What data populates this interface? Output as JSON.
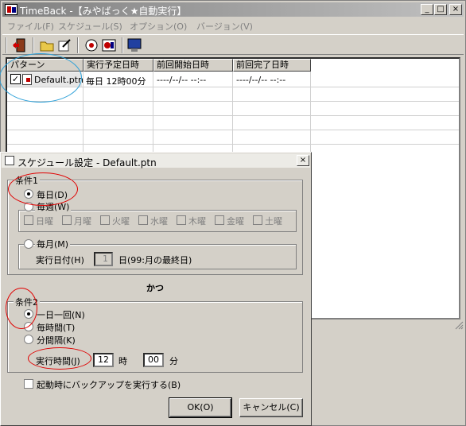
{
  "window": {
    "title": "TimeBack -【みやばっく★自動実行】",
    "controls": {
      "minimize": "_",
      "maximize": "□",
      "close": "×"
    }
  },
  "menu": [
    {
      "label": "ファイル(F)"
    },
    {
      "label": "スケジュール(S)"
    },
    {
      "label": "オプション(O)"
    },
    {
      "label": "バージョン(V)"
    }
  ],
  "toolbar": {
    "buttons": [
      {
        "icon": "exit-door-icon"
      },
      {
        "icon": "open-folder-icon"
      },
      {
        "icon": "edit-icon"
      },
      {
        "icon": "schedule-disk-icon"
      },
      {
        "icon": "run-icon"
      },
      {
        "icon": "monitor-icon"
      }
    ]
  },
  "list": {
    "columns": [
      "パターン",
      "実行予定日時",
      "前回開始日時",
      "前回完了日時"
    ],
    "rows": [
      {
        "checked": true,
        "check_mark": "✓",
        "pattern": "Default.ptn",
        "next_run": "毎日 12時00分",
        "last_start": "----/--/-- --:--",
        "last_end": "----/--/-- --:--"
      }
    ]
  },
  "dialog": {
    "title": "スケジュール設定 - Default.ptn",
    "close": "×",
    "condition1": {
      "label": "条件1",
      "daily": "毎日(D)",
      "weekly": "毎週(W)",
      "weekdays": [
        "日曜",
        "月曜",
        "火曜",
        "水曜",
        "木曜",
        "金曜",
        "土曜"
      ],
      "monthly": "毎月(M)",
      "run_day_label": "実行日付(H)",
      "run_day_value": "1",
      "run_day_suffix": "日(99:月の最終日)"
    },
    "and_label": "かつ",
    "condition2": {
      "label": "条件2",
      "once_a_day": "一日一回(N)",
      "hourly": "毎時間(T)",
      "interval": "分間隔(K)",
      "run_time_label": "実行時間(J)",
      "hour_value": "12",
      "hour_unit": "時",
      "minute_value": "00",
      "minute_unit": "分"
    },
    "startup_backup": "起動時にバックアップを実行する(B)",
    "ok": "OK(O)",
    "cancel": "キャンセル(C)"
  }
}
